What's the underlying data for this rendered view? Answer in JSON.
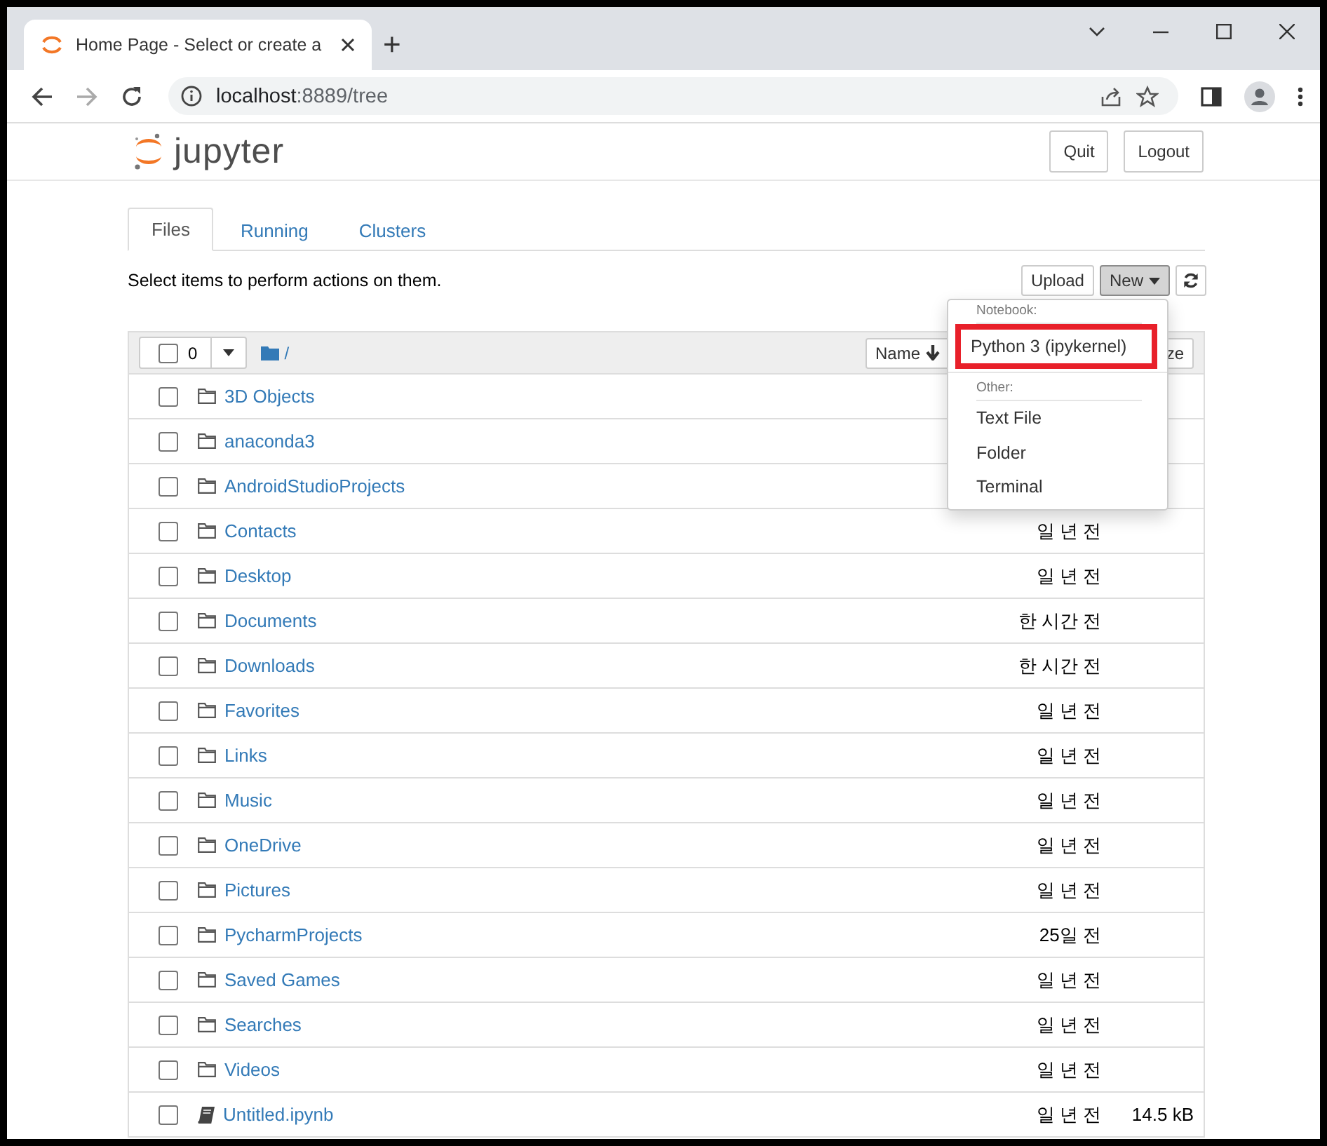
{
  "browser": {
    "tab_title": "Home Page - Select or create a",
    "new_tab": "+",
    "nav": [
      {
        "kind": "back",
        "disabled": false
      },
      {
        "kind": "forward",
        "disabled": true
      },
      {
        "kind": "reload",
        "disabled": false
      }
    ],
    "address": {
      "host": "localhost",
      "rest": ":8889/tree"
    }
  },
  "header": {
    "logo_text": "jupyter",
    "buttons": [
      "Quit",
      "Logout"
    ]
  },
  "tabs": [
    {
      "label": "Files",
      "selected": true
    },
    {
      "label": "Running",
      "selected": false
    },
    {
      "label": "Clusters",
      "selected": false
    }
  ],
  "hint": "Select items to perform actions on them.",
  "toolbar": {
    "upload": "Upload",
    "new": {
      "label": "New",
      "open": true
    }
  },
  "list_header": {
    "select_all_checked": false,
    "selected_count": "0",
    "path": "/",
    "sort_button": "Name",
    "column_2": "ze"
  },
  "rows": [
    {
      "kind": "folder",
      "name": "3D Objects",
      "checked": false
    },
    {
      "kind": "folder",
      "name": "anaconda3",
      "checked": false
    },
    {
      "kind": "folder",
      "name": "AndroidStudioProjects",
      "checked": false
    },
    {
      "kind": "folder",
      "name": "Contacts",
      "modified": "일 년 전",
      "checked": false
    },
    {
      "kind": "folder",
      "name": "Desktop",
      "modified": "일 년 전",
      "checked": false
    },
    {
      "kind": "folder",
      "name": "Documents",
      "modified": "한 시간 전",
      "checked": false
    },
    {
      "kind": "folder",
      "name": "Downloads",
      "modified": "한 시간 전",
      "checked": false
    },
    {
      "kind": "folder",
      "name": "Favorites",
      "modified": "일 년 전",
      "checked": false
    },
    {
      "kind": "folder",
      "name": "Links",
      "modified": "일 년 전",
      "checked": false
    },
    {
      "kind": "folder",
      "name": "Music",
      "modified": "일 년 전",
      "checked": false
    },
    {
      "kind": "folder",
      "name": "OneDrive",
      "modified": "일 년 전",
      "checked": false
    },
    {
      "kind": "folder",
      "name": "Pictures",
      "modified": "일 년 전",
      "checked": false
    },
    {
      "kind": "folder",
      "name": "PycharmProjects",
      "modified": "25일 전",
      "checked": false
    },
    {
      "kind": "folder",
      "name": "Saved Games",
      "modified": "일 년 전",
      "checked": false
    },
    {
      "kind": "folder",
      "name": "Searches",
      "modified": "일 년 전",
      "checked": false
    },
    {
      "kind": "folder",
      "name": "Videos",
      "modified": "일 년 전",
      "checked": false
    },
    {
      "kind": "notebook",
      "name": "Untitled.ipynb",
      "modified": "일 년 전",
      "size": "14.5 kB",
      "checked": false
    }
  ],
  "new_menu": {
    "sections": [
      {
        "heading": "Notebook:",
        "items": [
          {
            "label": "Python 3 (ipykernel)",
            "highlighted": true
          }
        ]
      },
      {
        "heading": "Other:",
        "items": [
          {
            "label": "Text File",
            "highlighted": false
          },
          {
            "label": "Folder",
            "highlighted": false
          },
          {
            "label": "Terminal",
            "highlighted": false
          }
        ]
      }
    ]
  }
}
